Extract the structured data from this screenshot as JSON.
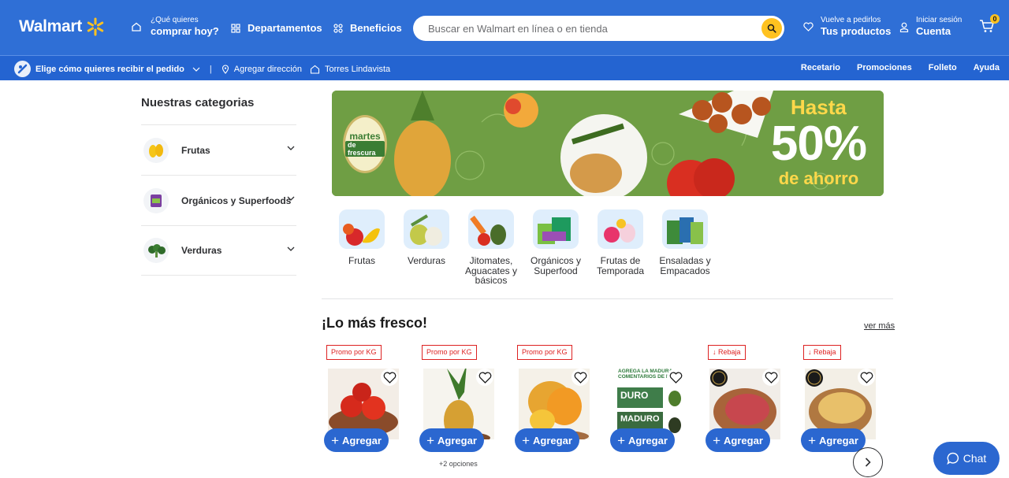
{
  "header": {
    "logo": "Walmart",
    "whatToBuy": {
      "small": "¿Qué quieres",
      "big": "comprar hoy?"
    },
    "departments": "Departamentos",
    "benefits": "Beneficios",
    "search_placeholder": "Buscar en Walmart en línea o en tienda",
    "reorder": {
      "small": "Vuelve a pedirlos",
      "big": "Tus productos"
    },
    "account": {
      "small": "Iniciar sesión",
      "big": "Cuenta"
    },
    "cart_count": "0"
  },
  "subbar": {
    "delivery": "Elige cómo quieres recibir el pedido",
    "address": "Agregar dirección",
    "store": "Torres Lindavista",
    "links": [
      "Recetario",
      "Promociones",
      "Folleto",
      "Ayuda"
    ]
  },
  "sidebar": {
    "title": "Nuestras categorias",
    "items": [
      {
        "label": "Frutas"
      },
      {
        "label": "Orgánicos y Superfoods"
      },
      {
        "label": "Verduras"
      }
    ]
  },
  "banner": {
    "badge_top": "martes",
    "badge_bottom": "de frescura",
    "hasta": "Hasta",
    "percent": "50%",
    "ahorro": "de ahorro"
  },
  "categories": [
    {
      "label": "Frutas"
    },
    {
      "label": "Verduras"
    },
    {
      "label": "Jitomates, Aguacates y básicos"
    },
    {
      "label": "Orgánicos y Superfood"
    },
    {
      "label": "Frutas de Temporada"
    },
    {
      "label": "Ensaladas y Empacados"
    }
  ],
  "section": {
    "title": "¡Lo más fresco!",
    "see_more": "ver más"
  },
  "products": [
    {
      "tag": "Promo por KG",
      "button": "Agregar",
      "options": ""
    },
    {
      "tag": "Promo por KG",
      "button": "Agregar",
      "options": "+2 opciones"
    },
    {
      "tag": "Promo por KG",
      "button": "Agregar",
      "options": ""
    },
    {
      "tag": "",
      "button": "Agregar",
      "options": "",
      "card_text": [
        "AGREGA LA MADURAC",
        "COMENTARIOS DE LA",
        "DURO",
        "MADURO"
      ]
    },
    {
      "tag": "Rebaja",
      "button": "Agregar",
      "options": ""
    },
    {
      "tag": "Rebaja",
      "button": "Agregar",
      "options": ""
    }
  ],
  "chat": "Chat",
  "colors": {
    "header": "#2f6fd6",
    "subbar": "#2464d1",
    "accent": "#ffc220",
    "button": "#2b67d0",
    "tag_red": "#dd2222"
  }
}
